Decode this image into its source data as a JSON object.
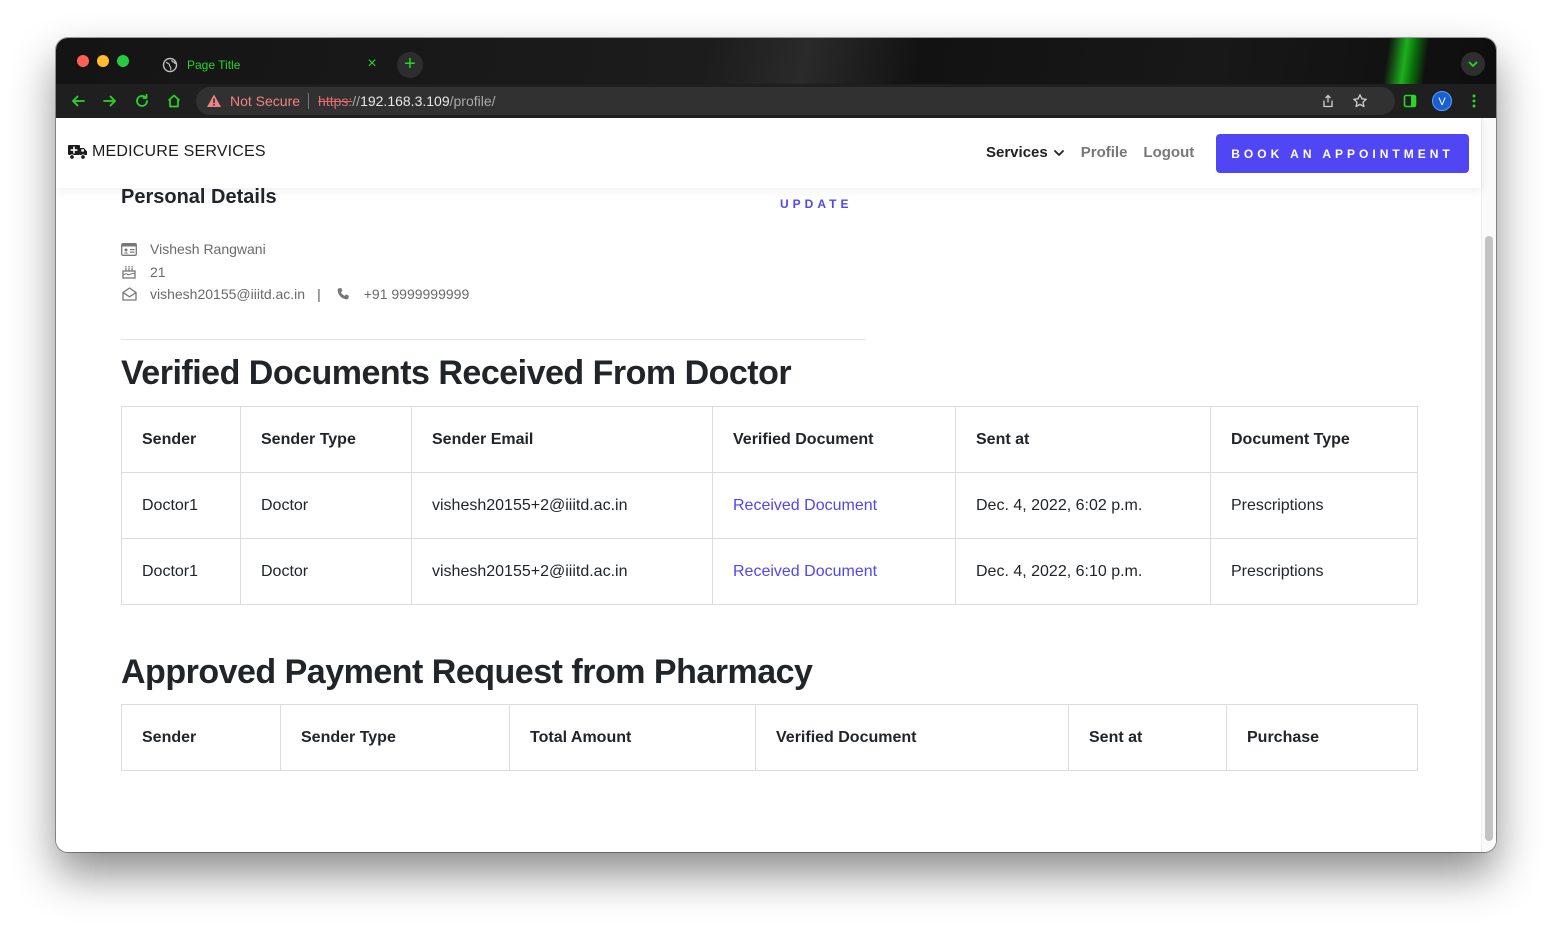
{
  "browser": {
    "tab_title": "Page Title",
    "tab_close": "×",
    "new_tab": "+",
    "security_label": "Not Secure",
    "url_scheme": "https:",
    "url_slashes": "//",
    "url_host": "192.168.3.109",
    "url_path": "/profile/",
    "profile_initial": "V",
    "accent_color": "#27d627"
  },
  "header": {
    "brand": "MEDICURE SERVICES",
    "nav": {
      "services": "Services",
      "profile": "Profile",
      "logout": "Logout"
    },
    "cta": "BOOK AN APPOINTMENT",
    "cta_color": "#5046f3"
  },
  "personal": {
    "title": "Personal Details",
    "update_label": "UPDATE",
    "name": "Vishesh Rangwani",
    "age": "21",
    "email": "vishesh20155@iiitd.ac.in",
    "separator": "|",
    "phone": "+91 9999999999"
  },
  "verified_docs": {
    "title": "Verified Documents Received From Doctor",
    "columns": [
      "Sender",
      "Sender Type",
      "Sender Email",
      "Verified Document",
      "Sent at",
      "Document Type"
    ],
    "rows": [
      [
        "Doctor1",
        "Doctor",
        "vishesh20155+2@iiitd.ac.in",
        "Received Document",
        "Dec. 4, 2022, 6:02 p.m.",
        "Prescriptions"
      ],
      [
        "Doctor1",
        "Doctor",
        "vishesh20155+2@iiitd.ac.in",
        "Received Document",
        "Dec. 4, 2022, 6:10 p.m.",
        "Prescriptions"
      ]
    ]
  },
  "payments": {
    "title": "Approved Payment Request from Pharmacy",
    "columns": [
      "Sender",
      "Sender Type",
      "Total Amount",
      "Verified Document",
      "Sent at",
      "Purchase"
    ]
  }
}
